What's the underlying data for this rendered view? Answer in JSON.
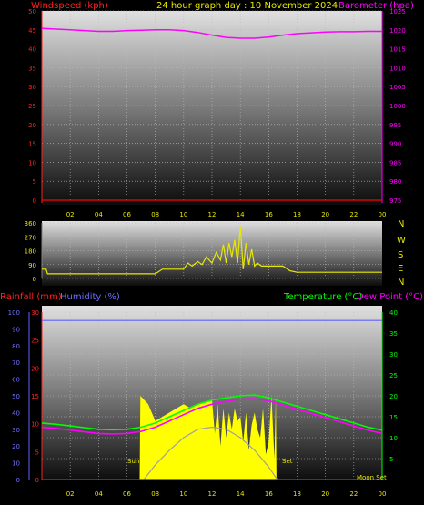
{
  "header": {
    "title": "24 hour graph day : 10 November 2024",
    "wind_label": "Windspeed (kph)",
    "baro_label": "Barometer (hpa)",
    "rain_label": "Rainfall (mm)",
    "hum_label": "Humidity (%)",
    "temp_label": "Temperature (°C)",
    "dew_label": "Dew Point (°C)"
  },
  "annotations": {
    "sun_rise": "Sun",
    "sun_set": "Set",
    "moon_set": "Moon Set"
  },
  "compass": [
    "N",
    "W",
    "S",
    "E",
    "N"
  ],
  "colors": {
    "wind": "#ff0000",
    "baro": "#ff00ff",
    "winddir": "#e8e800",
    "rain": "#ff0000",
    "humidity": "#6060ff",
    "temp": "#00ff00",
    "dew": "#ff00ff",
    "sun": "#ffff00",
    "sunarc": "#a0a0a0",
    "title": "#e8e800"
  },
  "chart_data": [
    {
      "type": "line",
      "name": "wind-barometer",
      "x_ticks": [
        "02",
        "04",
        "06",
        "08",
        "10",
        "12",
        "14",
        "16",
        "18",
        "20",
        "22",
        "00"
      ],
      "y_left": {
        "label": "Windspeed (kph)",
        "ylim": [
          0,
          50
        ],
        "ticks": [
          0,
          5,
          10,
          15,
          20,
          25,
          30,
          35,
          40,
          45,
          50
        ]
      },
      "y_right": {
        "label": "Barometer (hpa)",
        "ylim": [
          975,
          1025
        ],
        "ticks": [
          975,
          980,
          985,
          990,
          995,
          1000,
          1005,
          1010,
          1015,
          1020,
          1025
        ]
      },
      "xlim": [
        0,
        24
      ],
      "grid": true,
      "series": [
        {
          "name": "Windspeed (kph)",
          "axis": "left",
          "x": [
            0,
            24
          ],
          "y": [
            0,
            0
          ]
        },
        {
          "name": "Barometer (hpa)",
          "axis": "right",
          "x": [
            0,
            1,
            2,
            3,
            4,
            5,
            6,
            7,
            8,
            9,
            10,
            11,
            12,
            13,
            14,
            15,
            16,
            17,
            18,
            19,
            20,
            21,
            22,
            23,
            24
          ],
          "y": [
            1020.4,
            1020.2,
            1020.0,
            1019.8,
            1019.6,
            1019.6,
            1019.8,
            1019.9,
            1020.0,
            1020.0,
            1019.8,
            1019.3,
            1018.6,
            1018.0,
            1017.8,
            1017.8,
            1018.1,
            1018.6,
            1019.0,
            1019.2,
            1019.4,
            1019.5,
            1019.5,
            1019.6,
            1019.6
          ]
        }
      ]
    },
    {
      "type": "line",
      "name": "wind-direction",
      "x_ticks": [],
      "y_left": {
        "ticks": [
          0,
          90,
          180,
          270,
          360
        ],
        "ylim": [
          0,
          360
        ]
      },
      "xlim": [
        0,
        24
      ],
      "grid": true,
      "series": [
        {
          "name": "Wind direction",
          "x": [
            0,
            0.3,
            0.4,
            2,
            4,
            6,
            8,
            8.5,
            9,
            10,
            10.3,
            10.6,
            11,
            11.3,
            11.6,
            12,
            12.3,
            12.6,
            12.8,
            13,
            13.2,
            13.4,
            13.6,
            13.8,
            14,
            14.2,
            14.4,
            14.6,
            14.8,
            15,
            15.2,
            15.5,
            16,
            17,
            17.5,
            18,
            20,
            22,
            24
          ],
          "y": [
            60,
            60,
            30,
            30,
            30,
            30,
            30,
            60,
            60,
            60,
            100,
            80,
            110,
            90,
            140,
            100,
            170,
            120,
            220,
            100,
            230,
            140,
            250,
            100,
            340,
            60,
            230,
            90,
            190,
            80,
            100,
            80,
            80,
            80,
            50,
            40,
            40,
            40,
            40
          ]
        }
      ]
    },
    {
      "type": "line",
      "name": "temperature-humidity-rain",
      "x_ticks": [
        "02",
        "04",
        "06",
        "08",
        "10",
        "12",
        "14",
        "16",
        "18",
        "20",
        "22",
        "00"
      ],
      "y_left_rain": {
        "label": "Rainfall (mm)",
        "ylim": [
          0,
          30
        ],
        "ticks": [
          0,
          5,
          10,
          15,
          20,
          25,
          30
        ]
      },
      "y_left_hum": {
        "label": "Humidity (%)",
        "ylim": [
          0,
          100
        ],
        "ticks": [
          0,
          10,
          20,
          30,
          40,
          50,
          60,
          70,
          80,
          90,
          100
        ]
      },
      "y_right": {
        "label": "Temperature (°C)",
        "ylim": [
          0,
          40
        ],
        "ticks": [
          5,
          10,
          15,
          20,
          25,
          30,
          35,
          40
        ]
      },
      "xlim": [
        0,
        24
      ],
      "grid": true,
      "series": [
        {
          "name": "Humidity (%)",
          "axis": "hum",
          "x": [
            0,
            24
          ],
          "y": [
            95,
            95
          ]
        },
        {
          "name": "Rainfall (mm)",
          "axis": "rain",
          "x": [
            0,
            24
          ],
          "y": [
            0,
            0
          ]
        },
        {
          "name": "Temperature (°C)",
          "axis": "right",
          "x": [
            0,
            1,
            2,
            3,
            4,
            5,
            6,
            7,
            8,
            9,
            10,
            11,
            12,
            13,
            14,
            15,
            16,
            17,
            18,
            19,
            20,
            21,
            22,
            23,
            24
          ],
          "y": [
            13.5,
            13.2,
            12.8,
            12.4,
            12.0,
            11.9,
            12.0,
            12.5,
            13.5,
            15.0,
            16.5,
            18.0,
            19.0,
            19.5,
            20.0,
            20.2,
            19.5,
            18.5,
            17.5,
            16.5,
            15.5,
            14.5,
            13.5,
            12.5,
            11.8
          ]
        },
        {
          "name": "Dew Point (°C)",
          "axis": "right",
          "x": [
            0,
            1,
            2,
            3,
            4,
            5,
            6,
            7,
            8,
            9,
            10,
            11,
            12,
            13,
            14,
            15,
            16,
            17,
            18,
            19,
            20,
            21,
            22,
            23,
            24
          ],
          "y": [
            12.5,
            12.2,
            11.8,
            11.4,
            11.0,
            10.9,
            11.0,
            11.5,
            12.5,
            14.0,
            15.5,
            17.0,
            18.0,
            18.7,
            19.2,
            19.3,
            18.8,
            17.8,
            16.8,
            15.8,
            14.8,
            13.8,
            12.8,
            11.8,
            11.0
          ]
        },
        {
          "name": "Solar",
          "axis": "right",
          "kind": "area",
          "x": [
            6.9,
            6.95,
            7.5,
            8.0,
            8.5,
            9.0,
            9.5,
            10.0,
            10.5,
            11.0,
            11.5,
            12.0,
            12.2,
            12.4,
            12.6,
            12.8,
            13.0,
            13.2,
            13.4,
            13.6,
            13.8,
            14.0,
            14.2,
            14.4,
            14.6,
            14.8,
            15.0,
            15.2,
            15.4,
            15.6,
            15.8,
            16.0,
            16.2,
            16.4,
            16.5,
            16.55
          ],
          "y": [
            0,
            20,
            18,
            14,
            15,
            16,
            17,
            18,
            17,
            18,
            18.5,
            19,
            11,
            18,
            8,
            17,
            10,
            16,
            12,
            17,
            14,
            15,
            9,
            16,
            7,
            13,
            16,
            12,
            10,
            17,
            6,
            9,
            20,
            5,
            20,
            0
          ]
        },
        {
          "name": "Sun arc",
          "axis": "right",
          "x": [
            7.2,
            8,
            9,
            10,
            11,
            12,
            13,
            14,
            15,
            16,
            16.6
          ],
          "y": [
            0,
            3.5,
            7,
            10,
            12,
            12.5,
            12,
            10,
            7,
            3,
            0
          ]
        }
      ]
    }
  ]
}
